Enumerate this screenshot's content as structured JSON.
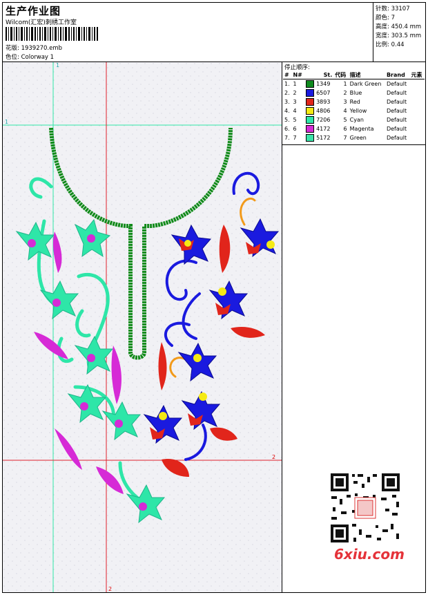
{
  "header": {
    "title": "生产作业图",
    "company": "Wilcom(汇宏)刺绣工作室",
    "design_label": "花版:",
    "design_value": "1939270.emb",
    "colorway_label": "色位:",
    "colorway_value": "Colorway 1"
  },
  "stats": {
    "stitches_label": "针数:",
    "stitches_value": "33107",
    "colors_label": "颜色:",
    "colors_value": "7",
    "height_label": "高度:",
    "height_value": "450.4 mm",
    "width_label": "宽度:",
    "width_value": "303.5 mm",
    "scale_label": "比例:",
    "scale_value": "0.44"
  },
  "guides": {
    "top_left": "1",
    "left_top": "1",
    "right_mid": "2",
    "bottom": "2"
  },
  "stop_sequence": {
    "caption": "停止顺序:",
    "headers": [
      "#",
      "N#",
      "St.",
      "代码",
      "描述",
      "Brand",
      "元素"
    ],
    "rows": [
      {
        "idx": "1.",
        "n": "1",
        "color": "#0f8a1e",
        "st": "1349",
        "code": "1",
        "desc": "Dark Green",
        "brand": "Default"
      },
      {
        "idx": "2.",
        "n": "2",
        "color": "#1a1adf",
        "st": "6507",
        "code": "2",
        "desc": "Blue",
        "brand": "Default"
      },
      {
        "idx": "3.",
        "n": "3",
        "color": "#e1251b",
        "st": "3893",
        "code": "3",
        "desc": "Red",
        "brand": "Default"
      },
      {
        "idx": "4.",
        "n": "4",
        "color": "#f5ea14",
        "st": "4806",
        "code": "4",
        "desc": "Yellow",
        "brand": "Default"
      },
      {
        "idx": "5.",
        "n": "5",
        "color": "#2ee6a8",
        "st": "7206",
        "code": "5",
        "desc": "Cyan",
        "brand": "Default"
      },
      {
        "idx": "6.",
        "n": "6",
        "color": "#d62ad6",
        "st": "4172",
        "code": "6",
        "desc": "Magenta",
        "brand": "Default"
      },
      {
        "idx": "7.",
        "n": "7",
        "color": "#3ae3a8",
        "st": "5172",
        "code": "7",
        "desc": "Green",
        "brand": "Default"
      }
    ]
  },
  "watermark": {
    "text": "6xiu.com"
  }
}
